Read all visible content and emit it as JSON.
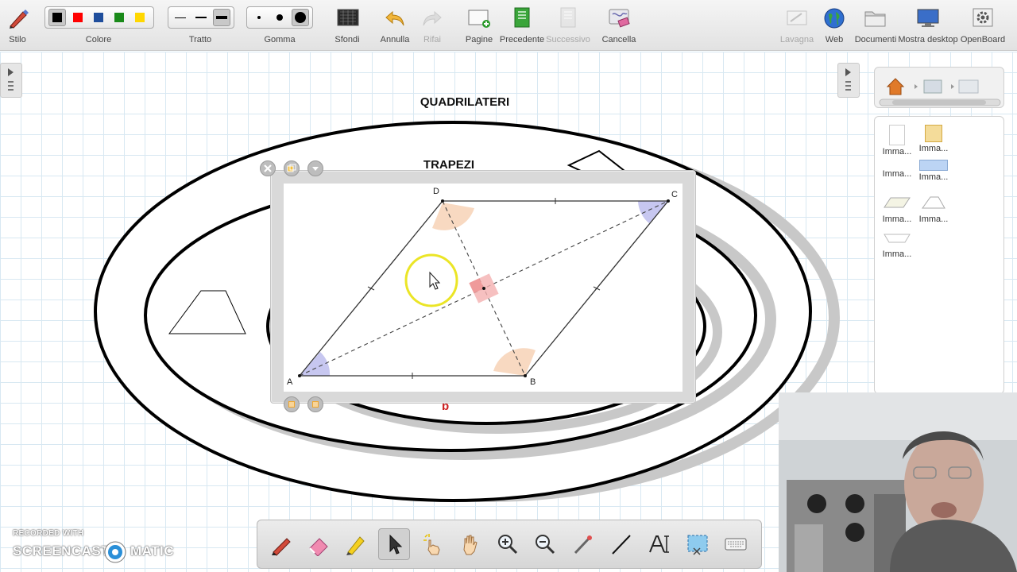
{
  "toolbar": {
    "stilo": "Stilo",
    "colore": "Colore",
    "tratto": "Tratto",
    "gomma": "Gomma",
    "sfondi": "Sfondi",
    "annulla": "Annulla",
    "rifai": "Rifai",
    "pagine": "Pagine",
    "precedente": "Precedente",
    "successivo": "Successivo",
    "cancella": "Cancella",
    "lavagna": "Lavagna",
    "web": "Web",
    "documenti": "Documenti",
    "mostra_desktop": "Mostra desktop",
    "openboard": "OpenBoard",
    "colors": [
      "#000000",
      "#ff0000",
      "#1f4e9c",
      "#1a8a1a",
      "#ffd700"
    ]
  },
  "board": {
    "title_quadrilateri": "QUADRILATERI",
    "title_trapezi": "TRAPEZI",
    "label_b": "b"
  },
  "geometry": {
    "point_a": "A",
    "point_b": "B",
    "point_c": "C",
    "point_d": "D"
  },
  "library": {
    "items": [
      "Imma...",
      "Imma...",
      "Imma...",
      "Imma...",
      "Imma...",
      "Imma...",
      "Imma..."
    ]
  },
  "watermark": {
    "recorded_with": "RECORDED WITH",
    "screencast": "SCREENCAST",
    "matic": "MATIC"
  },
  "colors": {
    "angle_orange": "#f5c9a6",
    "angle_blue": "#b9b9ec",
    "right_angle_red": "#f0a0a0",
    "cursor_highlight": "#e8e000"
  }
}
